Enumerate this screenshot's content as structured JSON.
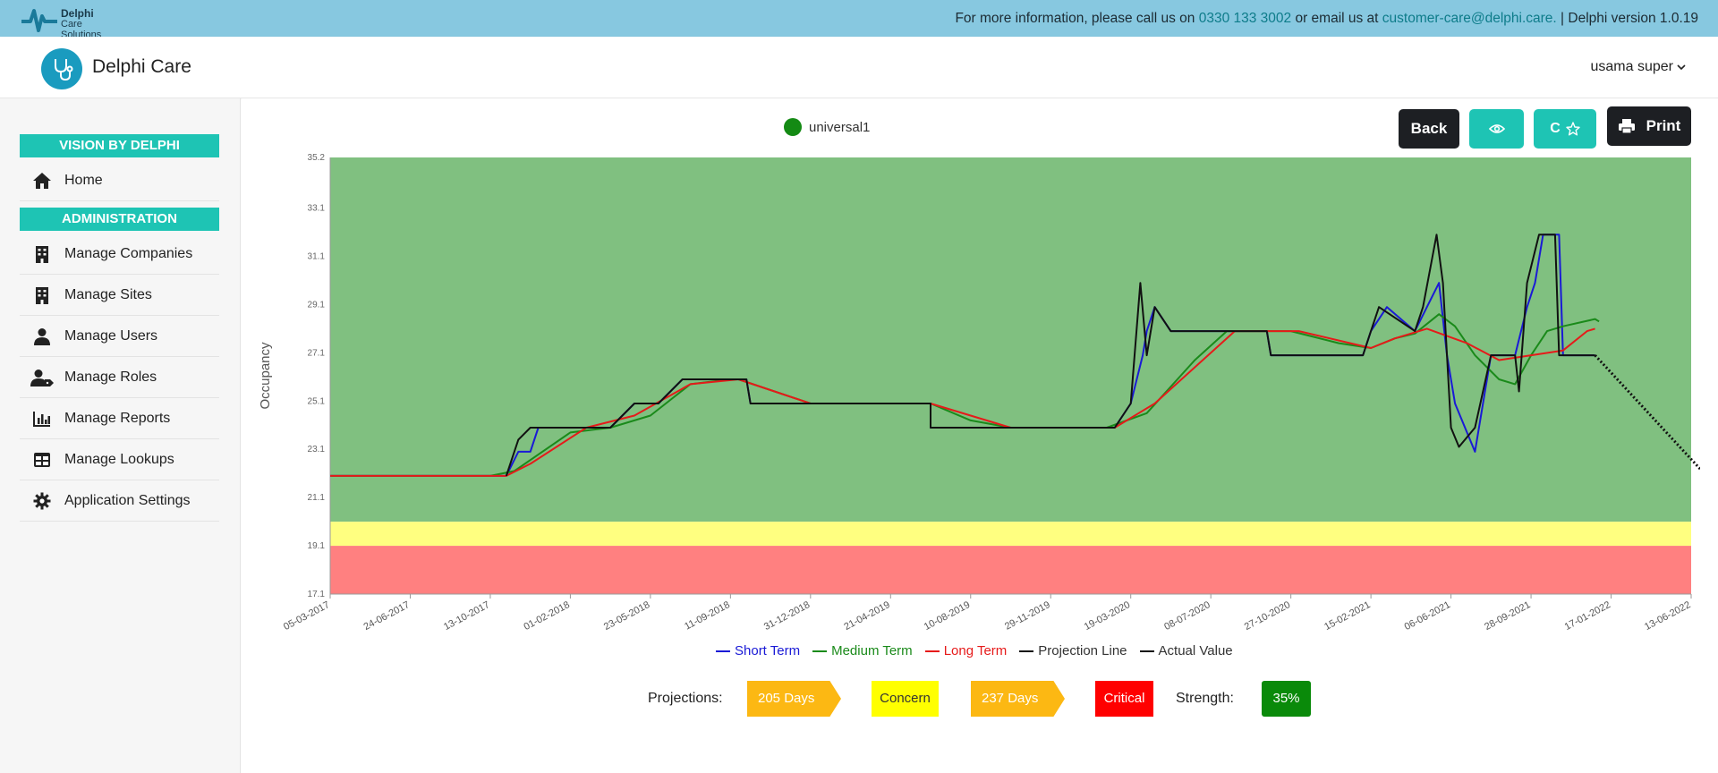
{
  "topbar": {
    "logo_line1": "Delphi",
    "logo_line2": "Care Solutions",
    "info_prefix": "For more information, please call us on ",
    "phone": "0330 133 3002",
    "info_mid": " or email us at ",
    "email": "customer-care@delphi.care.",
    "info_suffix": " | Delphi version 1.0.19"
  },
  "header": {
    "brand": "Delphi Care",
    "user": "usama super"
  },
  "sidebar": {
    "section1": "VISION BY DELPHI",
    "home": "Home",
    "section2": "ADMINISTRATION",
    "items": [
      {
        "label": "Manage Companies",
        "icon": "building-icon"
      },
      {
        "label": "Manage Sites",
        "icon": "building-icon"
      },
      {
        "label": "Manage Users",
        "icon": "user-icon"
      },
      {
        "label": "Manage Roles",
        "icon": "user-tag-icon"
      },
      {
        "label": "Manage Reports",
        "icon": "bar-chart-icon"
      },
      {
        "label": "Manage Lookups",
        "icon": "table-icon"
      },
      {
        "label": "Application Settings",
        "icon": "gear-icon"
      }
    ]
  },
  "toolbar": {
    "back": "Back",
    "c_label": "C",
    "print": "Print"
  },
  "chart_legend_top": "universal1",
  "chart_data": {
    "type": "line",
    "ylabel": "Occupancy",
    "ylim": [
      17.1,
      35.2
    ],
    "yticks": [
      "35.2",
      "33.1",
      "31.1",
      "29.1",
      "27.1",
      "25.1",
      "23.1",
      "21.1",
      "19.1",
      "17.1"
    ],
    "xticks": [
      "05-03-2017",
      "24-06-2017",
      "13-10-2017",
      "01-02-2018",
      "23-05-2018",
      "11-09-2018",
      "31-12-2018",
      "21-04-2019",
      "10-08-2019",
      "29-11-2019",
      "19-03-2020",
      "08-07-2020",
      "27-10-2020",
      "15-02-2021",
      "06-06-2021",
      "28-09-2021",
      "17-01-2022",
      "13-06-2022"
    ],
    "bands": [
      {
        "name": "green",
        "from": 20.1,
        "to": 35.2,
        "color": "#80c080"
      },
      {
        "name": "yellow",
        "from": 19.1,
        "to": 20.1,
        "color": "#ffff80"
      },
      {
        "name": "red",
        "from": 17.1,
        "to": 19.1,
        "color": "#ff8080"
      }
    ],
    "series": [
      {
        "name": "Short Term",
        "color": "#1a1ad6",
        "points": [
          [
            0,
            22
          ],
          [
            0.5,
            22
          ],
          [
            2.2,
            22
          ],
          [
            2.35,
            23
          ],
          [
            2.5,
            23
          ],
          [
            2.6,
            24
          ],
          [
            3.5,
            24
          ],
          [
            3.8,
            25
          ],
          [
            4.1,
            25
          ],
          [
            4.4,
            26
          ],
          [
            5.2,
            26
          ],
          [
            5.25,
            25
          ],
          [
            6.0,
            25
          ],
          [
            7.5,
            25
          ],
          [
            7.5,
            24
          ],
          [
            9.8,
            24
          ],
          [
            10.0,
            25
          ],
          [
            10.15,
            27
          ],
          [
            10.2,
            28
          ],
          [
            10.3,
            29
          ],
          [
            10.5,
            28
          ],
          [
            11.7,
            28
          ],
          [
            11.75,
            27
          ],
          [
            12.0,
            27
          ],
          [
            12.9,
            27
          ],
          [
            13.0,
            28
          ],
          [
            13.2,
            29
          ],
          [
            13.55,
            28
          ],
          [
            13.7,
            29
          ],
          [
            13.85,
            30
          ],
          [
            13.95,
            27
          ],
          [
            14.05,
            25
          ],
          [
            14.3,
            23
          ],
          [
            14.5,
            27
          ],
          [
            14.8,
            27
          ],
          [
            14.95,
            29
          ],
          [
            15.05,
            30
          ],
          [
            15.15,
            32
          ],
          [
            15.35,
            32
          ],
          [
            15.4,
            27
          ],
          [
            15.8,
            27
          ]
        ]
      },
      {
        "name": "Medium Term",
        "color": "#1a8a1a",
        "points": [
          [
            0,
            22
          ],
          [
            2.0,
            22
          ],
          [
            2.3,
            22.2
          ],
          [
            3.0,
            23.8
          ],
          [
            3.5,
            24
          ],
          [
            4.0,
            24.5
          ],
          [
            4.5,
            25.8
          ],
          [
            5.0,
            26
          ],
          [
            5.1,
            26
          ],
          [
            6.0,
            25
          ],
          [
            7.5,
            25
          ],
          [
            8.0,
            24.3
          ],
          [
            8.5,
            24
          ],
          [
            9.7,
            24
          ],
          [
            10.2,
            24.6
          ],
          [
            10.8,
            26.8
          ],
          [
            11.2,
            28
          ],
          [
            11.4,
            28
          ],
          [
            12.0,
            28
          ],
          [
            12.6,
            27.5
          ],
          [
            13.0,
            27.3
          ],
          [
            13.3,
            27.7
          ],
          [
            13.55,
            27.9
          ],
          [
            13.85,
            28.7
          ],
          [
            14.05,
            28.2
          ],
          [
            14.3,
            27
          ],
          [
            14.6,
            26
          ],
          [
            14.8,
            25.8
          ],
          [
            15.0,
            27
          ],
          [
            15.2,
            28
          ],
          [
            15.4,
            28.2
          ],
          [
            15.8,
            28.5
          ],
          [
            15.85,
            28.4
          ]
        ]
      },
      {
        "name": "Long Term",
        "color": "#e61a1a",
        "points": [
          [
            0,
            22
          ],
          [
            2.2,
            22
          ],
          [
            2.5,
            22.5
          ],
          [
            3.2,
            24
          ],
          [
            3.8,
            24.5
          ],
          [
            4.5,
            25.8
          ],
          [
            5.1,
            26
          ],
          [
            6.0,
            25
          ],
          [
            7.5,
            25
          ],
          [
            8.5,
            24
          ],
          [
            9.8,
            24
          ],
          [
            10.3,
            25
          ],
          [
            11.3,
            28
          ],
          [
            12.1,
            28
          ],
          [
            13.0,
            27.3
          ],
          [
            13.3,
            27.7
          ],
          [
            13.7,
            28.1
          ],
          [
            14.2,
            27.5
          ],
          [
            14.6,
            26.8
          ],
          [
            15.0,
            27
          ],
          [
            15.4,
            27.2
          ],
          [
            15.7,
            28
          ],
          [
            15.8,
            28.1
          ]
        ]
      },
      {
        "name": "Projection Line",
        "color": "#111111",
        "points": [
          [
            15.8,
            27
          ],
          [
            18.0,
            19.1
          ]
        ]
      },
      {
        "name": "Actual Value",
        "color": "#111111",
        "points": [
          [
            2.2,
            22
          ],
          [
            2.35,
            23.5
          ],
          [
            2.5,
            24
          ],
          [
            3.5,
            24
          ],
          [
            3.8,
            25
          ],
          [
            4.1,
            25
          ],
          [
            4.4,
            26
          ],
          [
            5.2,
            26
          ],
          [
            5.25,
            25
          ],
          [
            6.0,
            25
          ],
          [
            7.5,
            25
          ],
          [
            7.5,
            24
          ],
          [
            9.8,
            24
          ],
          [
            10.0,
            25
          ],
          [
            10.12,
            30
          ],
          [
            10.2,
            27
          ],
          [
            10.3,
            29
          ],
          [
            10.5,
            28
          ],
          [
            11.7,
            28
          ],
          [
            11.75,
            27
          ],
          [
            12.0,
            27
          ],
          [
            12.9,
            27
          ],
          [
            13.0,
            28
          ],
          [
            13.1,
            29
          ],
          [
            13.55,
            28
          ],
          [
            13.65,
            29
          ],
          [
            13.82,
            32
          ],
          [
            13.9,
            30
          ],
          [
            14.0,
            24
          ],
          [
            14.1,
            23.2
          ],
          [
            14.3,
            24
          ],
          [
            14.5,
            27
          ],
          [
            14.8,
            27
          ],
          [
            14.85,
            25.5
          ],
          [
            14.95,
            30
          ],
          [
            15.1,
            32
          ],
          [
            15.3,
            32
          ],
          [
            15.35,
            27
          ],
          [
            15.8,
            27
          ]
        ]
      }
    ],
    "projection_style": "dotted"
  },
  "series_legend": [
    {
      "label": "Short Term",
      "color": "#1a1ad6"
    },
    {
      "label": "Medium Term",
      "color": "#1a8a1a"
    },
    {
      "label": "Long Term",
      "color": "#e61a1a"
    },
    {
      "label": "Projection Line",
      "color": "#111111"
    },
    {
      "label": "Actual Value",
      "color": "#111111"
    }
  ],
  "projections": {
    "label": "Projections:",
    "days1": "205 Days",
    "concern": "Concern",
    "days2": "237 Days",
    "critical": "Critical",
    "strength_label": "Strength:",
    "strength": "35%"
  }
}
